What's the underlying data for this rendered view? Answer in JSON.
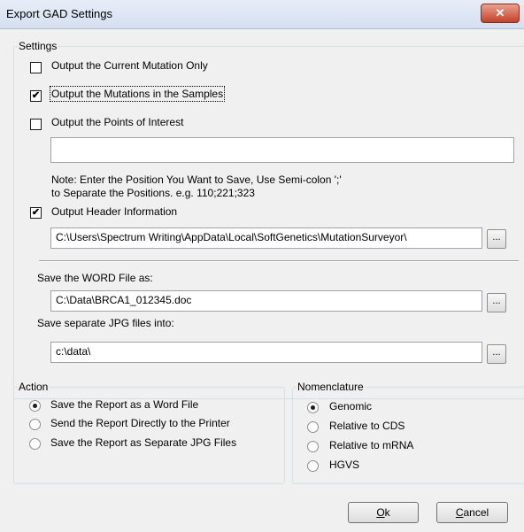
{
  "window": {
    "title": "Export GAD Settings",
    "close_glyph": "✕"
  },
  "settings": {
    "legend": "Settings",
    "current_mutation_only": {
      "label": "Output the Current Mutation Only",
      "checked": false
    },
    "mutations_in_samples": {
      "label": "Output the Mutations in the Samples",
      "checked": true
    },
    "points_of_interest": {
      "label": "Output the Points of Interest",
      "checked": false,
      "value": ""
    },
    "note_line1": "Note: Enter the Position You Want to Save, Use Semi-colon ';'",
    "note_line2": "to Separate the Positions. e.g. 110;221;323",
    "header_information": {
      "label": "Output Header Information",
      "checked": true,
      "path": "C:\\Users\\Spectrum Writing\\AppData\\Local\\SoftGenetics\\MutationSurveyor\\"
    },
    "word_file_label": "Save the WORD File as:",
    "word_file_path": "C:\\Data\\BRCA1_012345.doc",
    "jpg_folder_label": "Save separate JPG files into:",
    "jpg_folder_path": "c:\\data\\",
    "browse_label": "..."
  },
  "action": {
    "legend": "Action",
    "options": [
      {
        "label": "Save the Report as a Word File",
        "selected": true
      },
      {
        "label": "Send the Report Directly to the Printer",
        "selected": false
      },
      {
        "label": "Save the Report as Separate JPG Files",
        "selected": false
      }
    ]
  },
  "nomenclature": {
    "legend": "Nomenclature",
    "options": [
      {
        "label": "Genomic",
        "selected": true
      },
      {
        "label": "Relative to CDS",
        "selected": false
      },
      {
        "label": "Relative to mRNA",
        "selected": false
      },
      {
        "label": "HGVS",
        "selected": false
      }
    ]
  },
  "buttons": {
    "ok": {
      "mnemonic": "O",
      "rest": "k"
    },
    "cancel": {
      "mnemonic": "C",
      "rest": "ancel"
    }
  },
  "icons": {
    "check_glyph": "✔",
    "close": "close-icon",
    "browse": "ellipsis"
  }
}
